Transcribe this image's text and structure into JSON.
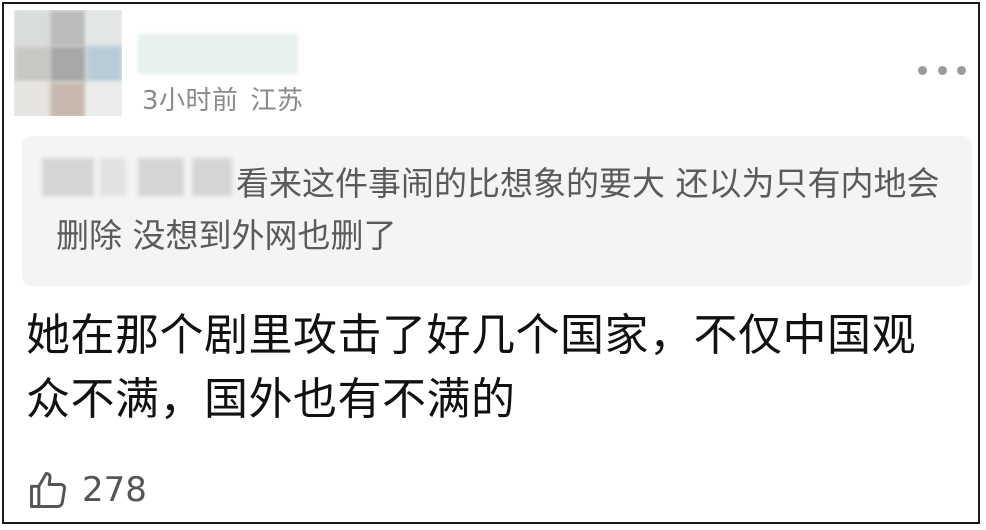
{
  "comment": {
    "time": "3小时前",
    "location": "江苏",
    "quote": {
      "text": "看来这件事闹的比想象的要大 还以为只有内地会删除 没想到外网也删了"
    },
    "body": "她在那个剧里攻击了好几个国家，不仅中国观众不满，国外也有不满的",
    "likes": "278"
  },
  "icons": {
    "more": "more-dots-icon",
    "like": "thumbs-up-icon"
  },
  "colors": {
    "meta_text": "#8a8a8a",
    "quote_bg": "#f4f4f4",
    "quote_text": "#5a5a5a",
    "body_text": "#111111"
  }
}
